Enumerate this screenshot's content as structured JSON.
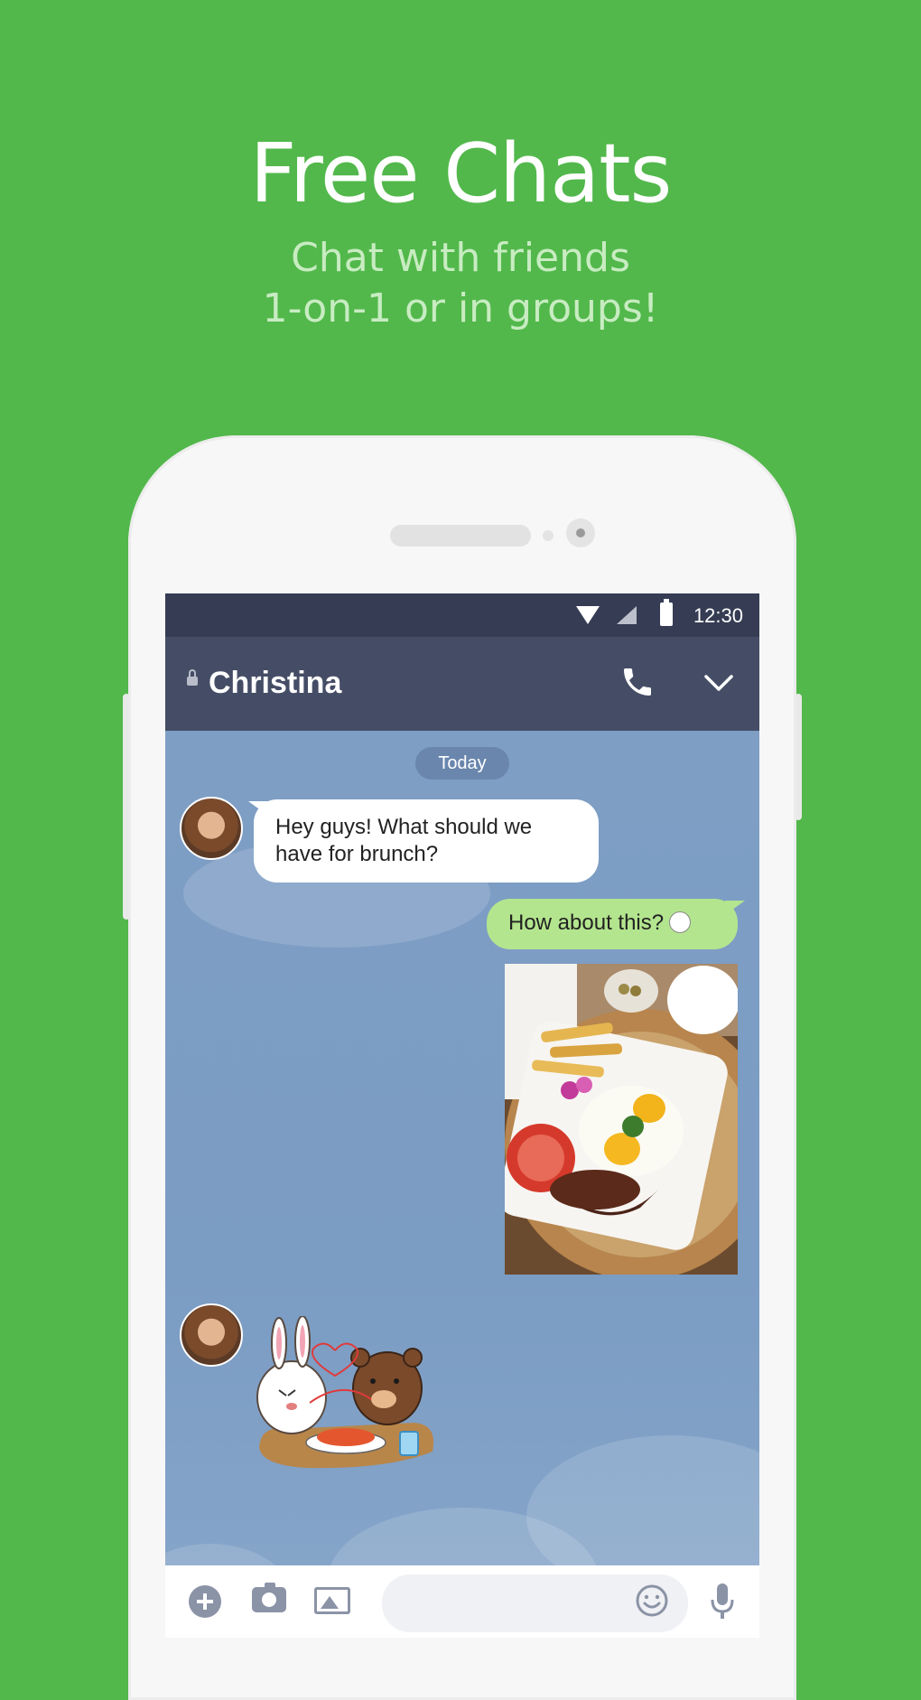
{
  "promo": {
    "title": "Free Chats",
    "subtitle_line1": "Chat with friends",
    "subtitle_line2": "1-on-1 or in groups!"
  },
  "status_bar": {
    "time": "12:30",
    "icons": [
      "wifi-icon",
      "signal-icon",
      "battery-icon"
    ]
  },
  "chat": {
    "title": "Christina",
    "locked": true,
    "header_icons": [
      "call-icon",
      "chevron-down-icon"
    ],
    "date_divider": "Today",
    "messages": [
      {
        "from": "Christina",
        "direction": "incoming",
        "text_line1": "Hey guys! What should we",
        "text_line2": "have for brunch?"
      },
      {
        "from": "me",
        "direction": "outgoing",
        "text": "How about this?"
      },
      {
        "from": "me",
        "direction": "outgoing",
        "type": "photo",
        "content": "brunch-plate"
      },
      {
        "from": "Christina",
        "direction": "incoming",
        "type": "sticker",
        "content": "cony-and-brown"
      }
    ]
  },
  "input_bar": {
    "icons": [
      "add-icon",
      "camera-icon",
      "image-icon",
      "emoji-icon",
      "mic-icon"
    ],
    "placeholder": ""
  },
  "colors": {
    "background": "#52b84b",
    "header": "#454d66",
    "status_bar": "#353c53",
    "chat_background": "#7d9ec4",
    "outgoing_bubble": "#b3e58e",
    "incoming_bubble": "#ffffff"
  }
}
